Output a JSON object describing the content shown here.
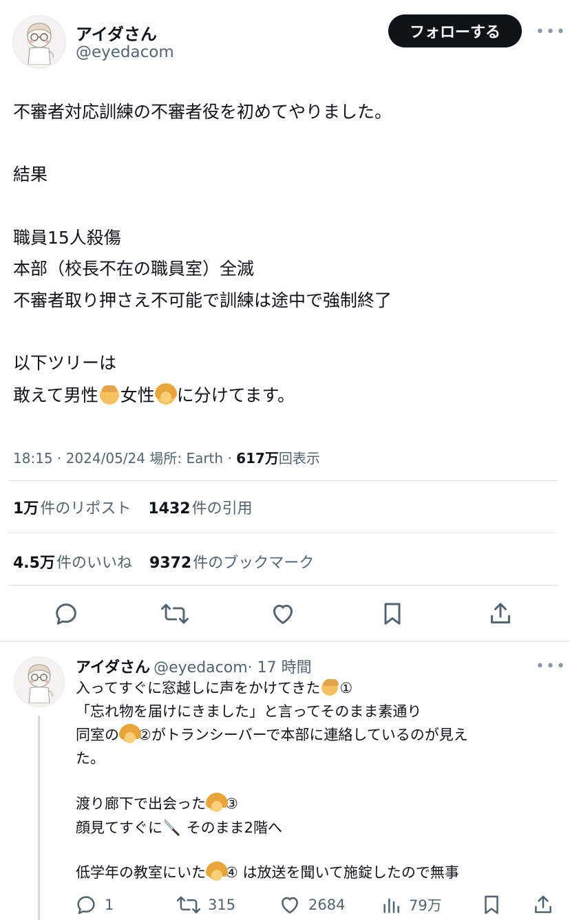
{
  "header": {
    "display_name": "アイダさん",
    "handle": "@eyedacom",
    "follow_label": "フォローする",
    "more_label": "•••"
  },
  "tweet": {
    "lines": {
      "l1": "不審者対応訓練の不審者役を初めてやりました。",
      "l2": "結果",
      "l3": "職員15人殺傷",
      "l4": "本部（校長不在の職員室）全滅",
      "l5": "不審者取り押さえ不可能で訓練は途中で強制終了",
      "l6": "以下ツリーは",
      "l7a": "敢えて男性",
      "l7b": "女性",
      "l7c": "に分けてます。"
    },
    "meta": {
      "time_date": "18:15 · 2024/05/24",
      "location": "場所: Earth",
      "sep": "·",
      "views_value": "617万",
      "views_label": "回表示"
    },
    "stats": {
      "reposts_value": "1万",
      "reposts_label": "件のリポスト",
      "quotes_value": "1432",
      "quotes_label": "件の引用",
      "likes_value": "4.5万",
      "likes_label": "件のいいね",
      "bookmarks_value": "9372",
      "bookmarks_label": "件のブックマーク"
    },
    "icons": [
      "reply-icon",
      "repost-icon",
      "like-icon",
      "bookmark-icon",
      "share-icon"
    ]
  },
  "reply": {
    "display_name": "アイダさん",
    "handle": "@eyedacom",
    "time": "· 17 時間",
    "more_label": "•••",
    "lines": {
      "r1a": "入ってすぐに窓越しに声をかけてきた",
      "r1b": "①",
      "r2": "「忘れ物を届けにきました」と言ってそのまま素通り",
      "r3a": "同室の",
      "r3b": "②がトランシーバーで本部に連絡しているのが見え",
      "r4": "た。",
      "r5a": "渡り廊下で出会った",
      "r5b": "③",
      "r6a": "顔見てすぐに",
      "r6b": " そのまま2階へ",
      "r7a": "低学年の教室にいた",
      "r7b": "④ は放送を聞いて施錠したので無事"
    },
    "actions": {
      "replies": "1",
      "reposts": "315",
      "likes": "2684",
      "views": "79万"
    }
  }
}
